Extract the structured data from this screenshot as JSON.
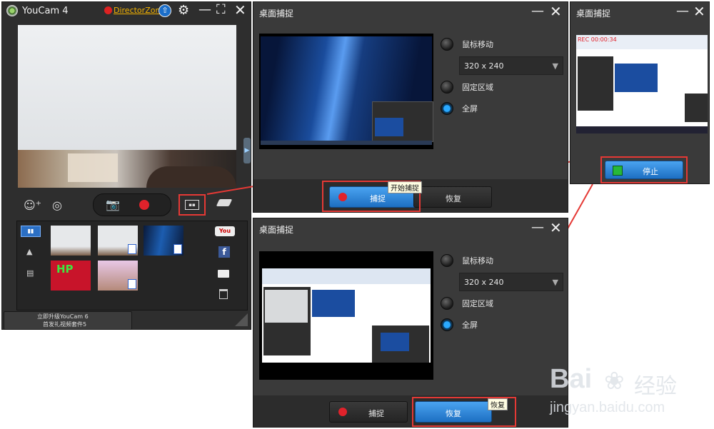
{
  "youcam": {
    "title": "YouCam 4",
    "director_zone": "DirectorZone",
    "promo_line1": "立即升级YouCam 6",
    "promo_line2": "首发礼视频套件5",
    "thumb_text": "HP"
  },
  "capture_dialogs": [
    {
      "title": "桌面捕捉",
      "options": {
        "mouse": "鼠标移动",
        "resolution": "320 x 240",
        "fixed": "固定区域",
        "full": "全屏"
      },
      "buttons": {
        "capture": "捕捉",
        "restore": "恢复"
      },
      "tooltip": "开始捕捉",
      "selected": "全屏"
    },
    {
      "title": "桌面捕捉",
      "options": {
        "mouse": "鼠标移动",
        "resolution": "320 x 240",
        "fixed": "固定区域",
        "full": "全屏"
      },
      "buttons": {
        "capture": "捕捉",
        "restore": "恢复"
      },
      "tooltip": "恢复",
      "selected": "全屏"
    }
  ],
  "recording_dialog": {
    "title": "桌面捕捉",
    "rec_label": "REC 00:00:34",
    "stop_button": "停止"
  },
  "watermark": {
    "brand": "Bai",
    "brand2": "经验",
    "url": "jingyan.baidu.com"
  },
  "colors": {
    "highlight": "#e53935",
    "accent_blue": "#2aa9ff",
    "window_bg": "#3a3a3a"
  }
}
